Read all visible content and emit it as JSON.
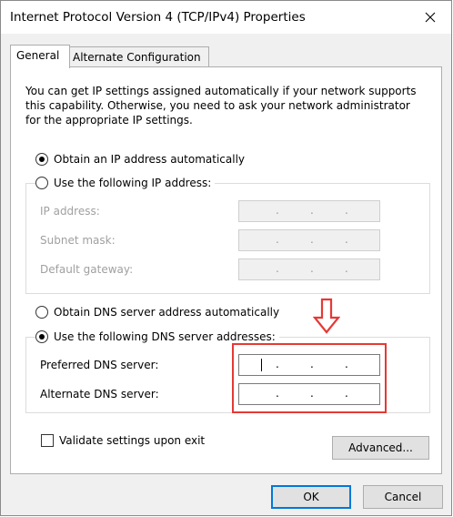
{
  "window": {
    "title": "Internet Protocol Version 4 (TCP/IPv4) Properties"
  },
  "tabs": [
    {
      "label": "General",
      "selected": true
    },
    {
      "label": "Alternate Configuration",
      "selected": false
    }
  ],
  "description": "You can get IP settings assigned automatically if your network supports this capability. Otherwise, you need to ask your network administrator for the appropriate IP settings.",
  "ip_section": {
    "auto_label": "Obtain an IP address automatically",
    "manual_label": "Use the following IP address:",
    "selected": "auto",
    "fields": [
      {
        "label": "IP address:",
        "value": ". . ."
      },
      {
        "label": "Subnet mask:",
        "value": ". . ."
      },
      {
        "label": "Default gateway:",
        "value": ". . ."
      }
    ]
  },
  "dns_section": {
    "auto_label": "Obtain DNS server address automatically",
    "manual_label": "Use the following DNS server addresses:",
    "selected": "manual",
    "fields": [
      {
        "label": "Preferred DNS server:",
        "value": ". . ."
      },
      {
        "label": "Alternate DNS server:",
        "value": ". . ."
      }
    ]
  },
  "validate_checkbox": {
    "label": "Validate settings upon exit",
    "checked": false
  },
  "buttons": {
    "advanced": "Advanced...",
    "ok": "OK",
    "cancel": "Cancel"
  },
  "annotation": {
    "highlight_color": "#e53935",
    "arrow": "down-arrow"
  },
  "colors": {
    "accent": "#0078d7",
    "dialog_bg": "#f0f0f0"
  }
}
